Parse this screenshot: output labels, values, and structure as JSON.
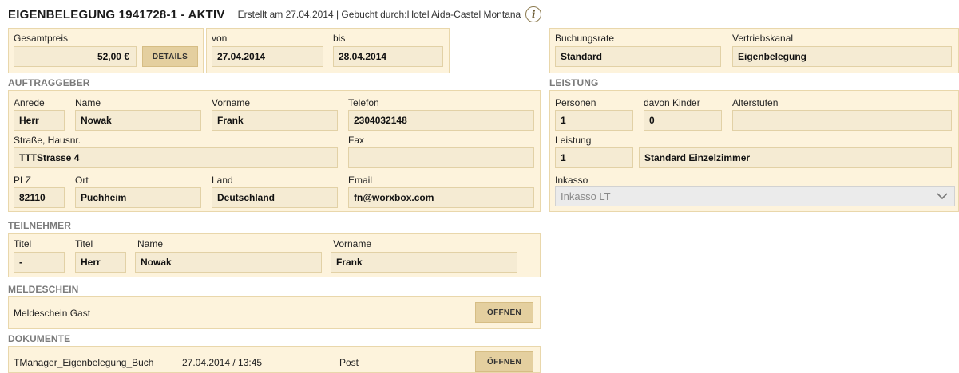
{
  "header": {
    "title": "EIGENBELEGUNG 1941728-1 - AKTIV",
    "subtitle": "Erstellt am 27.04.2014 | Gebucht durch:Hotel Aida-Castel Montana",
    "info_glyph": "i"
  },
  "price": {
    "label": "Gesamtpreis",
    "value": "52,00 €",
    "details_button": "DETAILS"
  },
  "dates": {
    "from_label": "von",
    "from_value": "27.04.2014",
    "to_label": "bis",
    "to_value": "28.04.2014"
  },
  "booking": {
    "rate_label": "Buchungsrate",
    "rate_value": "Standard",
    "channel_label": "Vertriebskanal",
    "channel_value": "Eigenbelegung"
  },
  "auftraggeber": {
    "section_title": "AUFTRAGGEBER",
    "anrede_label": "Anrede",
    "anrede_value": "Herr",
    "name_label": "Name",
    "name_value": "Nowak",
    "vorname_label": "Vorname",
    "vorname_value": "Frank",
    "telefon_label": "Telefon",
    "telefon_value": "2304032148",
    "strasse_label": "Straße, Hausnr.",
    "strasse_value": "TTTStrasse 4",
    "fax_label": "Fax",
    "fax_value": "",
    "plz_label": "PLZ",
    "plz_value": "82110",
    "ort_label": "Ort",
    "ort_value": "Puchheim",
    "land_label": "Land",
    "land_value": "Deutschland",
    "email_label": "Email",
    "email_value": "fn@worxbox.com"
  },
  "teilnehmer": {
    "section_title": "TEILNEHMER",
    "titel1_label": "Titel",
    "titel1_value": "-",
    "titel2_label": "Titel",
    "titel2_value": "Herr",
    "name_label": "Name",
    "name_value": "Nowak",
    "vorname_label": "Vorname",
    "vorname_value": "Frank"
  },
  "meldeschein": {
    "section_title": "MELDESCHEIN",
    "item_label": "Meldeschein Gast",
    "open_button": "ÖFFNEN"
  },
  "dokumente": {
    "section_title": "DOKUMENTE",
    "doc_name": "TManager_Eigenbelegung_Buch",
    "doc_date": "27.04.2014 / 13:45",
    "doc_type": "Post",
    "open_button": "ÖFFNEN"
  },
  "leistung": {
    "section_title": "LEISTUNG",
    "personen_label": "Personen",
    "personen_value": "1",
    "kinder_label": "davon Kinder",
    "kinder_value": "0",
    "alterstufen_label": "Alterstufen",
    "alterstufen_value": "",
    "leistung_label": "Leistung",
    "leistung_qty": "1",
    "leistung_value": "Standard Einzelzimmer",
    "inkasso_label": "Inkasso",
    "inkasso_selected": "Inkasso LT"
  },
  "colors": {
    "panel_bg": "#fdf3dc",
    "field_bg": "#f5ebd3",
    "button_bg": "#e4cf9f",
    "section_title": "#7a7a7a"
  }
}
